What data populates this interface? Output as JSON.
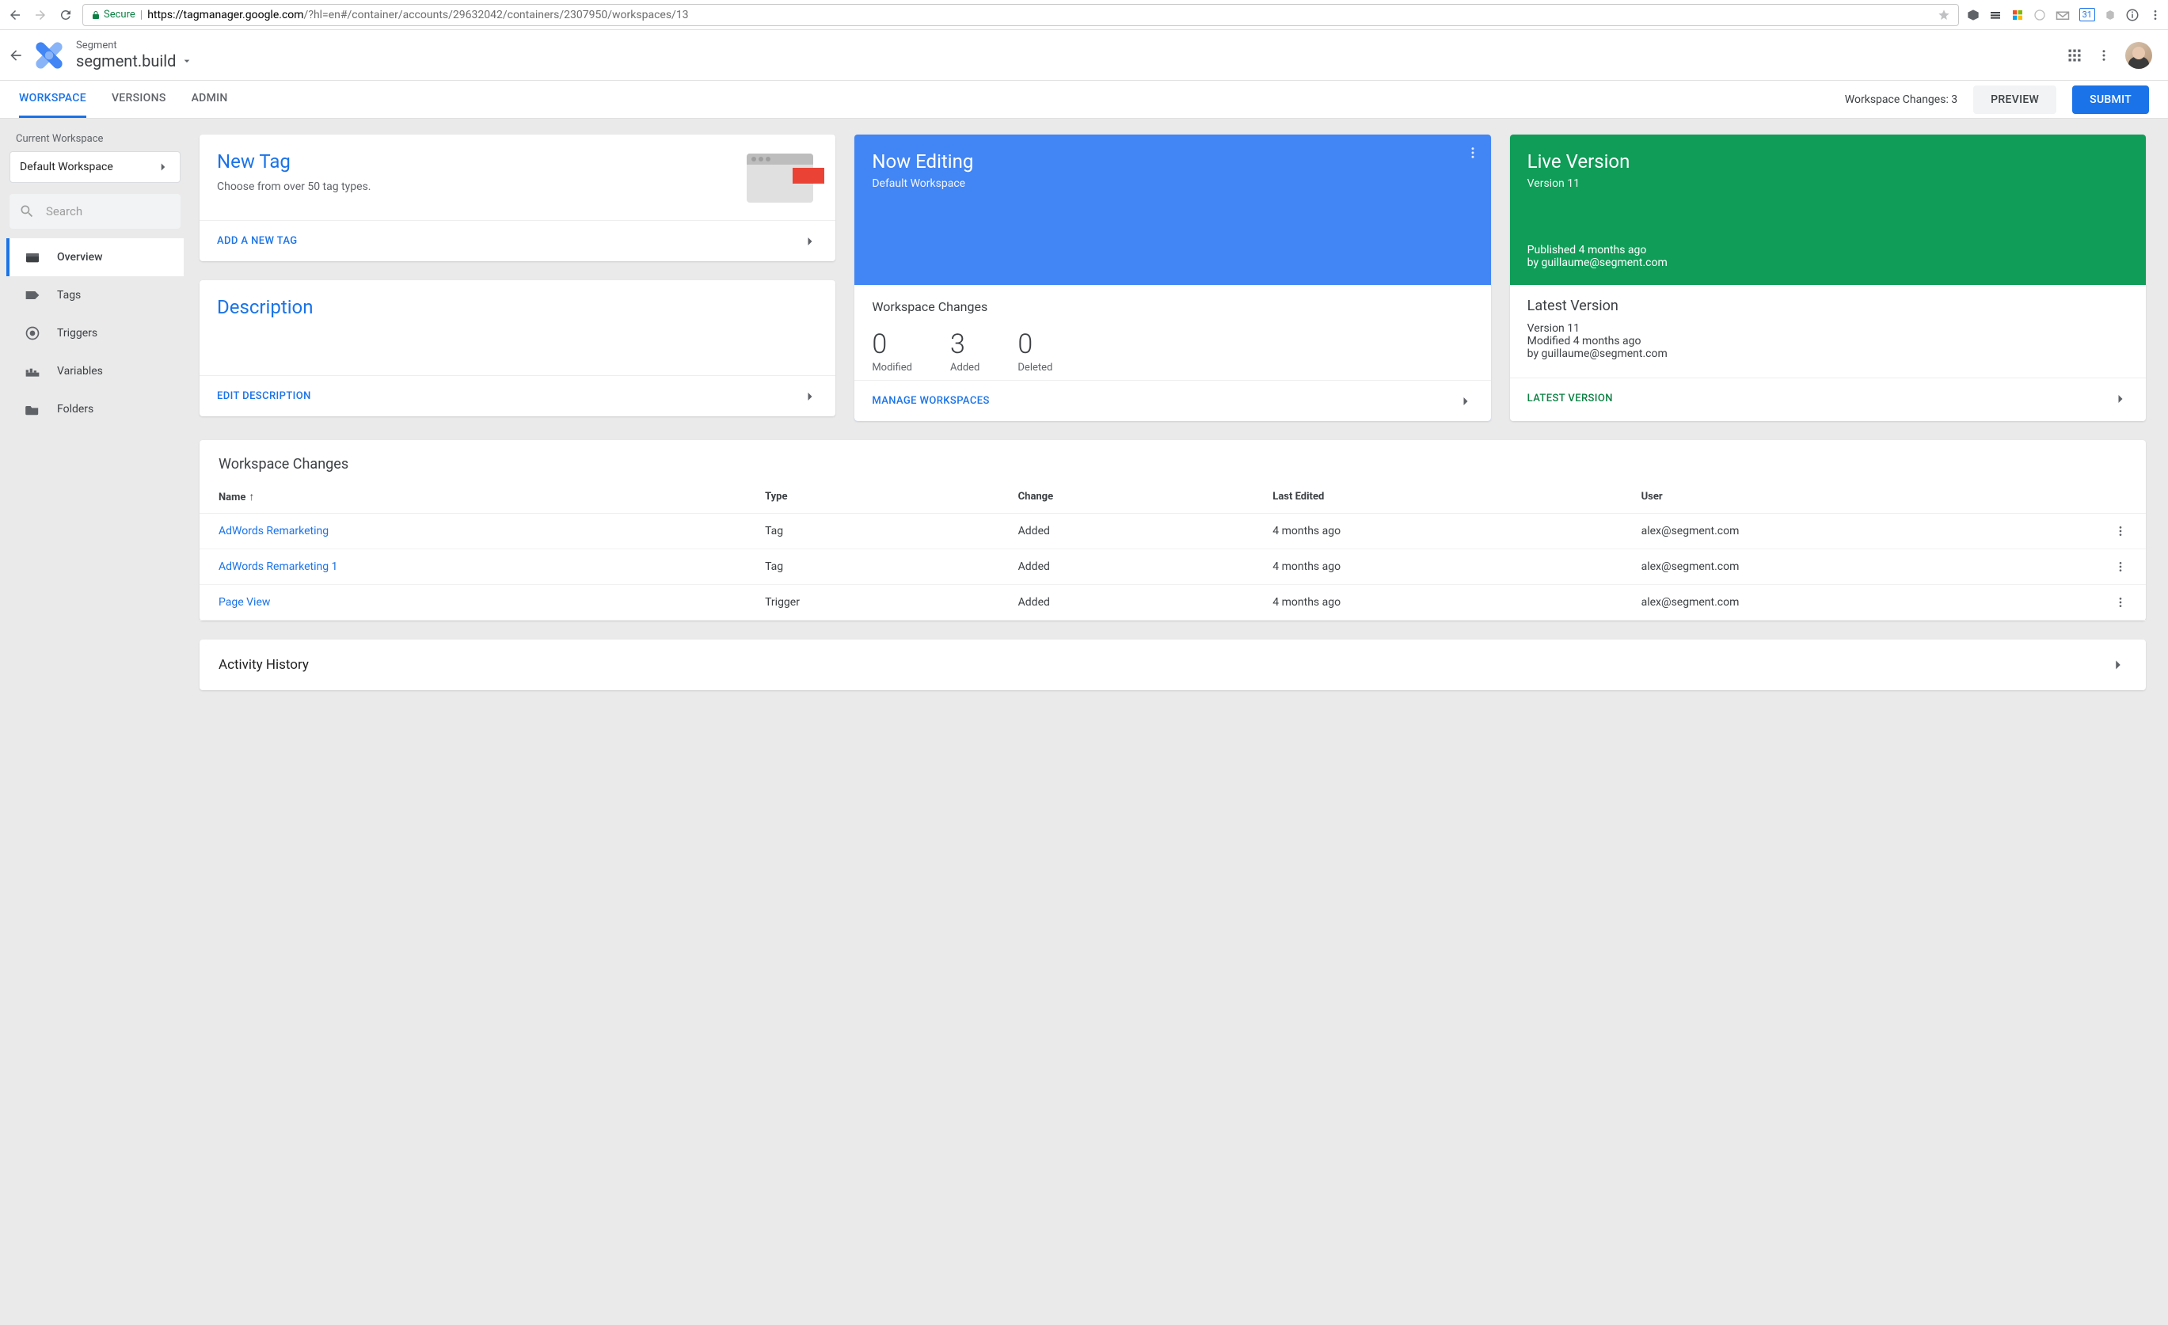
{
  "browser": {
    "secure_label": "Secure",
    "url_host": "https://tagmanager.google.com",
    "url_path": "/?hl=en#/container/accounts/29632042/containers/2307950/workspaces/13"
  },
  "header": {
    "breadcrumb_top": "Segment",
    "breadcrumb_main": "segment.build"
  },
  "tabs": {
    "workspace": "WORKSPACE",
    "versions": "VERSIONS",
    "admin": "ADMIN",
    "changes_label": "Workspace Changes: 3",
    "preview": "PREVIEW",
    "submit": "SUBMIT"
  },
  "sidebar": {
    "current_ws_label": "Current Workspace",
    "workspace_picker": "Default Workspace",
    "search_placeholder": "Search",
    "items": {
      "overview": "Overview",
      "tags": "Tags",
      "triggers": "Triggers",
      "variables": "Variables",
      "folders": "Folders"
    }
  },
  "cards": {
    "new_tag": {
      "title": "New Tag",
      "subtitle": "Choose from over 50 tag types.",
      "action": "ADD A NEW TAG"
    },
    "description": {
      "title": "Description",
      "action": "EDIT DESCRIPTION"
    },
    "now_editing": {
      "title": "Now Editing",
      "subtitle": "Default Workspace",
      "section_title": "Workspace Changes",
      "modified_val": "0",
      "modified_lbl": "Modified",
      "added_val": "3",
      "added_lbl": "Added",
      "deleted_val": "0",
      "deleted_lbl": "Deleted",
      "action": "MANAGE WORKSPACES"
    },
    "live_version": {
      "title": "Live Version",
      "subtitle": "Version 11",
      "published": "Published 4 months ago",
      "by": "by guillaume@segment.com",
      "latest_title": "Latest Version",
      "latest_line1": "Version 11",
      "latest_line2": "Modified 4 months ago",
      "latest_line3": "by guillaume@segment.com",
      "action": "LATEST VERSION"
    }
  },
  "changes_panel": {
    "title": "Workspace Changes",
    "columns": {
      "name": "Name",
      "type": "Type",
      "change": "Change",
      "last_edited": "Last Edited",
      "user": "User"
    },
    "rows": [
      {
        "name": "AdWords Remarketing",
        "type": "Tag",
        "change": "Added",
        "last_edited": "4 months ago",
        "user": "alex@segment.com"
      },
      {
        "name": "AdWords Remarketing 1",
        "type": "Tag",
        "change": "Added",
        "last_edited": "4 months ago",
        "user": "alex@segment.com"
      },
      {
        "name": "Page View",
        "type": "Trigger",
        "change": "Added",
        "last_edited": "4 months ago",
        "user": "alex@segment.com"
      }
    ]
  },
  "activity": {
    "title": "Activity History"
  }
}
